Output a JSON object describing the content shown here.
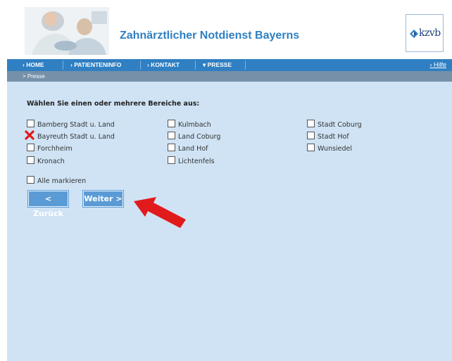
{
  "header": {
    "title": "Zahnärztlicher Notdienst Bayerns",
    "logo_text": "kzvb"
  },
  "nav": {
    "items": [
      "HOME",
      "PATIENTENINFO",
      "KONTAKT",
      "PRESSE"
    ],
    "help": "Hilfe"
  },
  "breadcrumb": ">  Presse",
  "form": {
    "heading": "Wählen Sie einen oder mehrere Bereiche aus:",
    "col1": [
      "Bamberg Stadt u. Land",
      "Bayreuth Stadt u. Land",
      "Forchheim",
      "Kronach"
    ],
    "col2": [
      "Kulmbach",
      "Land Coburg",
      "Land Hof",
      "Lichtenfels"
    ],
    "col3": [
      "Stadt Coburg",
      "Stadt Hof",
      "Wunsiedel"
    ],
    "select_all": "Alle markieren",
    "back": "< Zurück",
    "next": "Weiter >"
  }
}
